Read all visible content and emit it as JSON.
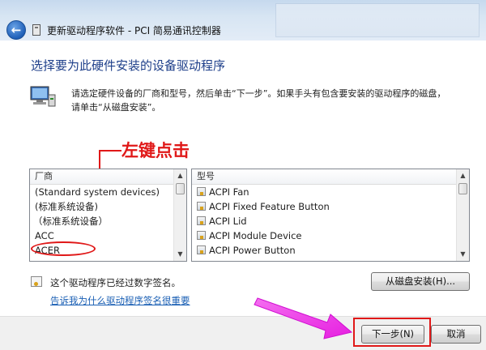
{
  "window": {
    "title": "更新驱动程序软件 - PCI 简易通讯控制器"
  },
  "heading": "选择要为此硬件安装的设备驱动程序",
  "instructions": {
    "line1": "请选定硬件设备的厂商和型号，然后单击“下一步”。如果手头有包含要安装的驱动程序的磁盘，",
    "line2": "请单击“从磁盘安装”。"
  },
  "annotation": "左键点击",
  "manufacturer_list": {
    "header": "厂商",
    "items": [
      "(Standard system devices)",
      "(标准系统设备)",
      "（标准系统设备）",
      "ACC",
      "ACER"
    ]
  },
  "model_list": {
    "header": "型号",
    "items": [
      "ACPI Fan",
      "ACPI Fixed Feature Button",
      "ACPI Lid",
      "ACPI Module Device",
      "ACPI Power Button"
    ]
  },
  "signature": {
    "text": "这个驱动程序已经过数字签名。",
    "link": "告诉我为什么驱动程序签名很重要"
  },
  "buttons": {
    "have_disk": "从磁盘安装(H)...",
    "next": "下一步(N)",
    "cancel": "取消"
  },
  "colors": {
    "annotation": "#e01818",
    "heading": "#1e3f8a",
    "link": "#1a5fb4",
    "arrow": "#ee2be2"
  },
  "icons": {
    "back": "back-arrow-icon",
    "device": "pci-device-icon",
    "computer": "computer-hardware-icon",
    "driver": "driver-package-icon",
    "signature": "signed-driver-icon"
  }
}
